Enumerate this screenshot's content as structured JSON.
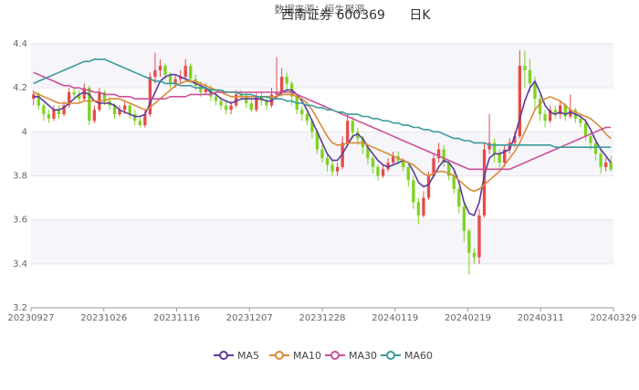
{
  "header": {
    "title": "西南证券 600369",
    "period": "日K",
    "watermark": "数据来源：恒生聚源"
  },
  "chart_data": {
    "type": "line",
    "subtype": "candlestick-with-moving-averages",
    "title": "西南证券 600369 日K",
    "xlabel": "",
    "ylabel": "",
    "ylim": [
      3.2,
      4.4
    ],
    "yticks": [
      "3.2",
      "3.4",
      "3.6",
      "3.8",
      "4",
      "4.2",
      "4.4"
    ],
    "x_tick_labels": [
      "20230927",
      "20231026",
      "20231116",
      "20231207",
      "20231228",
      "20240119",
      "20240219",
      "20240311",
      "20240329"
    ],
    "grid": "horizontal-bands",
    "legend_position": "bottom-center",
    "colors": {
      "up_candle": "#e64b4b",
      "down_candle": "#7ed321",
      "MA5": "#5b3b9e",
      "MA10": "#d98a3a",
      "MA30": "#cc4f9a",
      "MA60": "#3c9a9a"
    },
    "candles": [
      [
        4.15,
        4.17,
        4.19,
        4.12
      ],
      [
        4.17,
        4.12,
        4.18,
        4.1
      ],
      [
        4.12,
        4.08,
        4.13,
        4.05
      ],
      [
        4.08,
        4.06,
        4.1,
        4.04
      ],
      [
        4.06,
        4.1,
        4.12,
        4.05
      ],
      [
        4.1,
        4.08,
        4.12,
        4.06
      ],
      [
        4.08,
        4.12,
        4.14,
        4.07
      ],
      [
        4.12,
        4.18,
        4.2,
        4.11
      ],
      [
        4.18,
        4.17,
        4.2,
        4.15
      ],
      [
        4.17,
        4.15,
        4.19,
        4.13
      ],
      [
        4.15,
        4.2,
        4.22,
        4.14
      ],
      [
        4.2,
        4.05,
        4.21,
        4.03
      ],
      [
        4.05,
        4.1,
        4.12,
        4.04
      ],
      [
        4.1,
        4.18,
        4.2,
        4.09
      ],
      [
        4.18,
        4.14,
        4.19,
        4.12
      ],
      [
        4.14,
        4.12,
        4.16,
        4.1
      ],
      [
        4.12,
        4.08,
        4.13,
        4.06
      ],
      [
        4.08,
        4.1,
        4.12,
        4.07
      ],
      [
        4.1,
        4.12,
        4.14,
        4.08
      ],
      [
        4.12,
        4.08,
        4.13,
        4.06
      ],
      [
        4.08,
        4.05,
        4.1,
        4.03
      ],
      [
        4.05,
        4.03,
        4.07,
        4.02
      ],
      [
        4.03,
        4.08,
        4.1,
        4.02
      ],
      [
        4.08,
        4.25,
        4.27,
        4.07
      ],
      [
        4.25,
        4.28,
        4.36,
        4.22
      ],
      [
        4.28,
        4.3,
        4.33,
        4.25
      ],
      [
        4.3,
        4.26,
        4.31,
        4.24
      ],
      [
        4.26,
        4.22,
        4.27,
        4.2
      ],
      [
        4.22,
        4.24,
        4.26,
        4.2
      ],
      [
        4.24,
        4.25,
        4.28,
        4.22
      ],
      [
        4.25,
        4.3,
        4.33,
        4.24
      ],
      [
        4.3,
        4.24,
        4.31,
        4.22
      ],
      [
        4.24,
        4.21,
        4.26,
        4.19
      ],
      [
        4.21,
        4.18,
        4.23,
        4.16
      ],
      [
        4.18,
        4.2,
        4.22,
        4.17
      ],
      [
        4.2,
        4.16,
        4.21,
        4.14
      ],
      [
        4.16,
        4.14,
        4.18,
        4.12
      ],
      [
        4.14,
        4.12,
        4.16,
        4.1
      ],
      [
        4.12,
        4.1,
        4.14,
        4.08
      ],
      [
        4.1,
        4.12,
        4.14,
        4.08
      ],
      [
        4.12,
        4.17,
        4.19,
        4.11
      ],
      [
        4.17,
        4.16,
        4.19,
        4.14
      ],
      [
        4.16,
        4.13,
        4.18,
        4.11
      ],
      [
        4.13,
        4.1,
        4.15,
        4.09
      ],
      [
        4.1,
        4.16,
        4.18,
        4.09
      ],
      [
        4.16,
        4.14,
        4.18,
        4.12
      ],
      [
        4.14,
        4.12,
        4.16,
        4.1
      ],
      [
        4.12,
        4.17,
        4.2,
        4.11
      ],
      [
        4.17,
        4.18,
        4.34,
        4.15
      ],
      [
        4.18,
        4.25,
        4.29,
        4.16
      ],
      [
        4.25,
        4.22,
        4.27,
        4.19
      ],
      [
        4.22,
        4.16,
        4.23,
        4.12
      ],
      [
        4.16,
        4.1,
        4.17,
        4.08
      ],
      [
        4.1,
        4.08,
        4.12,
        4.05
      ],
      [
        4.08,
        4.05,
        4.1,
        4.03
      ],
      [
        4.05,
        4.0,
        4.06,
        3.97
      ],
      [
        4.0,
        3.92,
        4.01,
        3.9
      ],
      [
        3.92,
        3.88,
        3.94,
        3.86
      ],
      [
        3.88,
        3.85,
        3.9,
        3.82
      ],
      [
        3.85,
        3.82,
        3.87,
        3.8
      ],
      [
        3.82,
        3.84,
        3.86,
        3.8
      ],
      [
        3.84,
        3.95,
        3.98,
        3.83
      ],
      [
        3.95,
        4.05,
        4.08,
        3.94
      ],
      [
        4.05,
        4.0,
        4.07,
        3.97
      ],
      [
        4.0,
        3.97,
        4.02,
        3.94
      ],
      [
        3.97,
        3.93,
        3.98,
        3.9
      ],
      [
        3.93,
        3.88,
        3.95,
        3.85
      ],
      [
        3.88,
        3.84,
        3.89,
        3.81
      ],
      [
        3.84,
        3.8,
        3.85,
        3.78
      ],
      [
        3.8,
        3.83,
        3.85,
        3.79
      ],
      [
        3.83,
        3.86,
        3.88,
        3.82
      ],
      [
        3.86,
        3.89,
        3.91,
        3.85
      ],
      [
        3.89,
        3.87,
        3.91,
        3.85
      ],
      [
        3.87,
        3.84,
        3.88,
        3.82
      ],
      [
        3.84,
        3.78,
        3.85,
        3.75
      ],
      [
        3.78,
        3.68,
        3.8,
        3.65
      ],
      [
        3.68,
        3.62,
        3.7,
        3.58
      ],
      [
        3.62,
        3.7,
        3.73,
        3.61
      ],
      [
        3.7,
        3.8,
        3.82,
        3.69
      ],
      [
        3.8,
        3.88,
        3.9,
        3.79
      ],
      [
        3.88,
        3.92,
        3.95,
        3.86
      ],
      [
        3.92,
        3.86,
        3.94,
        3.84
      ],
      [
        3.86,
        3.8,
        3.87,
        3.78
      ],
      [
        3.8,
        3.74,
        3.82,
        3.72
      ],
      [
        3.74,
        3.66,
        3.75,
        3.63
      ],
      [
        3.66,
        3.55,
        3.68,
        3.5
      ],
      [
        3.55,
        3.45,
        3.56,
        3.35
      ],
      [
        3.45,
        3.43,
        3.47,
        3.4
      ],
      [
        3.43,
        3.62,
        3.65,
        3.4
      ],
      [
        3.62,
        3.92,
        3.95,
        3.61
      ],
      [
        3.92,
        3.95,
        4.08,
        3.9
      ],
      [
        3.95,
        3.9,
        3.97,
        3.86
      ],
      [
        3.9,
        3.86,
        3.92,
        3.83
      ],
      [
        3.86,
        3.92,
        3.94,
        3.84
      ],
      [
        3.92,
        3.95,
        3.97,
        3.9
      ],
      [
        3.95,
        3.98,
        4.0,
        3.93
      ],
      [
        3.98,
        4.3,
        4.37,
        3.97
      ],
      [
        4.3,
        4.28,
        4.37,
        4.2
      ],
      [
        4.28,
        4.22,
        4.33,
        4.18
      ],
      [
        4.22,
        4.15,
        4.25,
        4.1
      ],
      [
        4.15,
        4.08,
        4.17,
        4.05
      ],
      [
        4.08,
        4.05,
        4.1,
        4.02
      ],
      [
        4.05,
        4.1,
        4.12,
        4.04
      ],
      [
        4.1,
        4.08,
        4.12,
        4.06
      ],
      [
        4.08,
        4.12,
        4.14,
        4.06
      ],
      [
        4.12,
        4.07,
        4.13,
        4.05
      ],
      [
        4.07,
        4.1,
        4.17,
        4.06
      ],
      [
        4.1,
        4.06,
        4.11,
        4.04
      ],
      [
        4.06,
        4.04,
        4.08,
        4.02
      ],
      [
        4.04,
        3.98,
        4.06,
        3.96
      ],
      [
        3.98,
        3.95,
        4.0,
        3.92
      ],
      [
        3.95,
        3.9,
        3.97,
        3.87
      ],
      [
        3.9,
        3.84,
        3.92,
        3.81
      ],
      [
        3.84,
        3.86,
        3.88,
        3.82
      ],
      [
        3.86,
        3.83,
        3.89,
        3.82
      ]
    ],
    "series": [
      {
        "name": "MA5",
        "values": [
          4.16,
          4.16,
          4.14,
          4.12,
          4.1,
          4.1,
          4.11,
          4.13,
          4.15,
          4.17,
          4.18,
          4.17,
          4.14,
          4.13,
          4.13,
          4.13,
          4.12,
          4.1,
          4.09,
          4.08,
          4.07,
          4.07,
          4.08,
          4.13,
          4.18,
          4.23,
          4.25,
          4.26,
          4.26,
          4.25,
          4.24,
          4.23,
          4.22,
          4.21,
          4.2,
          4.18,
          4.17,
          4.15,
          4.14,
          4.13,
          4.14,
          4.15,
          4.15,
          4.15,
          4.15,
          4.15,
          4.14,
          4.14,
          4.16,
          4.18,
          4.19,
          4.19,
          4.17,
          4.14,
          4.1,
          4.05,
          4.0,
          3.95,
          3.9,
          3.87,
          3.87,
          3.9,
          3.94,
          3.98,
          3.99,
          3.97,
          3.93,
          3.9,
          3.87,
          3.85,
          3.84,
          3.85,
          3.86,
          3.87,
          3.86,
          3.82,
          3.77,
          3.75,
          3.76,
          3.8,
          3.84,
          3.87,
          3.86,
          3.83,
          3.77,
          3.68,
          3.63,
          3.62,
          3.68,
          3.8,
          3.88,
          3.9,
          3.9,
          3.91,
          3.92,
          3.98,
          4.06,
          4.14,
          4.2,
          4.23,
          4.18,
          4.12,
          4.09,
          4.08,
          4.09,
          4.08,
          4.09,
          4.08,
          4.07,
          4.05,
          4.01,
          3.96,
          3.92,
          3.89,
          3.86
        ]
      },
      {
        "name": "MA10",
        "values": [
          4.18,
          4.17,
          4.16,
          4.15,
          4.14,
          4.13,
          4.13,
          4.13,
          4.13,
          4.13,
          4.14,
          4.14,
          4.14,
          4.14,
          4.14,
          4.15,
          4.15,
          4.15,
          4.14,
          4.13,
          4.12,
          4.11,
          4.1,
          4.11,
          4.13,
          4.15,
          4.17,
          4.19,
          4.21,
          4.22,
          4.23,
          4.23,
          4.23,
          4.22,
          4.21,
          4.2,
          4.19,
          4.18,
          4.17,
          4.16,
          4.16,
          4.16,
          4.16,
          4.16,
          4.16,
          4.16,
          4.16,
          4.16,
          4.16,
          4.17,
          4.17,
          4.17,
          4.16,
          4.15,
          4.13,
          4.1,
          4.06,
          4.02,
          3.98,
          3.95,
          3.94,
          3.94,
          3.95,
          3.95,
          3.95,
          3.95,
          3.94,
          3.93,
          3.92,
          3.91,
          3.9,
          3.89,
          3.88,
          3.87,
          3.86,
          3.85,
          3.83,
          3.81,
          3.8,
          3.81,
          3.82,
          3.82,
          3.81,
          3.8,
          3.78,
          3.76,
          3.74,
          3.73,
          3.74,
          3.76,
          3.78,
          3.8,
          3.82,
          3.85,
          3.88,
          3.91,
          3.95,
          4.0,
          4.05,
          4.1,
          4.13,
          4.15,
          4.16,
          4.15,
          4.14,
          4.12,
          4.1,
          4.09,
          4.08,
          4.07,
          4.06,
          4.04,
          4.02,
          3.99,
          3.97
        ]
      },
      {
        "name": "MA30",
        "values": [
          4.27,
          4.26,
          4.25,
          4.24,
          4.23,
          4.22,
          4.21,
          4.21,
          4.2,
          4.2,
          4.19,
          4.19,
          4.18,
          4.18,
          4.17,
          4.17,
          4.17,
          4.16,
          4.16,
          4.16,
          4.15,
          4.15,
          4.15,
          4.15,
          4.15,
          4.15,
          4.15,
          4.16,
          4.16,
          4.16,
          4.16,
          4.17,
          4.17,
          4.17,
          4.17,
          4.17,
          4.18,
          4.18,
          4.18,
          4.18,
          4.18,
          4.18,
          4.18,
          4.18,
          4.18,
          4.18,
          4.18,
          4.18,
          4.18,
          4.18,
          4.18,
          4.18,
          4.17,
          4.16,
          4.15,
          4.14,
          4.13,
          4.12,
          4.11,
          4.1,
          4.09,
          4.08,
          4.07,
          4.06,
          4.05,
          4.04,
          4.03,
          4.02,
          4.01,
          4.0,
          3.99,
          3.98,
          3.97,
          3.96,
          3.95,
          3.94,
          3.93,
          3.92,
          3.91,
          3.9,
          3.89,
          3.88,
          3.87,
          3.86,
          3.85,
          3.84,
          3.83,
          3.83,
          3.83,
          3.83,
          3.83,
          3.83,
          3.83,
          3.83,
          3.83,
          3.84,
          3.85,
          3.86,
          3.87,
          3.88,
          3.89,
          3.9,
          3.91,
          3.92,
          3.93,
          3.94,
          3.95,
          3.96,
          3.97,
          3.98,
          3.99,
          4.0,
          4.01,
          4.02,
          4.02
        ]
      },
      {
        "name": "MA60",
        "values": [
          4.22,
          4.23,
          4.24,
          4.25,
          4.26,
          4.27,
          4.28,
          4.29,
          4.3,
          4.31,
          4.32,
          4.32,
          4.33,
          4.33,
          4.33,
          4.32,
          4.31,
          4.3,
          4.29,
          4.28,
          4.27,
          4.26,
          4.25,
          4.24,
          4.23,
          4.23,
          4.22,
          4.22,
          4.22,
          4.21,
          4.21,
          4.21,
          4.2,
          4.2,
          4.2,
          4.19,
          4.19,
          4.19,
          4.18,
          4.18,
          4.18,
          4.17,
          4.17,
          4.17,
          4.16,
          4.16,
          4.16,
          4.15,
          4.15,
          4.15,
          4.14,
          4.14,
          4.13,
          4.13,
          4.12,
          4.12,
          4.11,
          4.11,
          4.1,
          4.1,
          4.09,
          4.09,
          4.08,
          4.08,
          4.08,
          4.07,
          4.07,
          4.06,
          4.06,
          4.05,
          4.05,
          4.04,
          4.04,
          4.03,
          4.03,
          4.02,
          4.02,
          4.01,
          4.01,
          4.0,
          4.0,
          3.99,
          3.98,
          3.97,
          3.97,
          3.96,
          3.96,
          3.95,
          3.95,
          3.95,
          3.94,
          3.94,
          3.94,
          3.94,
          3.94,
          3.94,
          3.94,
          3.94,
          3.94,
          3.94,
          3.94,
          3.94,
          3.94,
          3.93,
          3.93,
          3.93,
          3.93,
          3.93,
          3.93,
          3.93,
          3.93,
          3.93,
          3.93,
          3.93,
          3.93
        ]
      }
    ]
  }
}
